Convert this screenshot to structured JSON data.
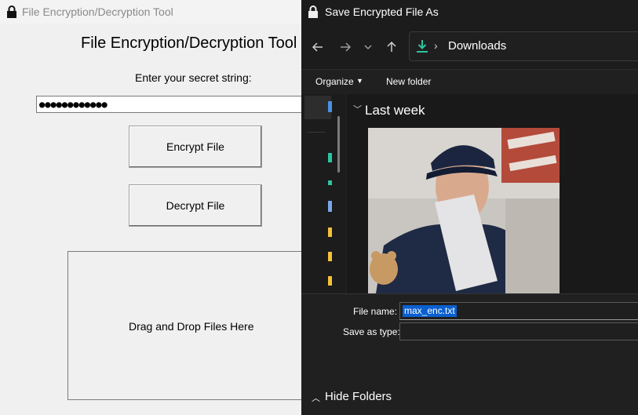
{
  "app": {
    "window_title": "File Encryption/Decryption Tool",
    "heading": "File Encryption/Decryption Tool",
    "secret_prompt": "Enter your secret string:",
    "secret_value": "●●●●●●●●●●●●",
    "encrypt_label": "Encrypt File",
    "decrypt_label": "Decrypt File",
    "drop_label": "Drag and Drop Files Here"
  },
  "dialog": {
    "title": "Save Encrypted File As",
    "nav": {
      "back_icon": "arrow-left-icon",
      "forward_icon": "arrow-right-icon",
      "recent_icon": "chevron-down-icon",
      "up_icon": "arrow-up-icon"
    },
    "address": {
      "separator": "›",
      "location": "Downloads",
      "icon": "download-icon"
    },
    "commands": {
      "organize": "Organize",
      "new_folder": "New folder"
    },
    "group_label": "Last week",
    "file_name_label": "File name:",
    "file_name_value": "max_enc.txt",
    "save_type_label": "Save as type:",
    "save_type_value": "",
    "hide_folders": "Hide Folders"
  },
  "colors": {
    "dialog_bg": "#202020",
    "selection": "#0a60d0",
    "download_accent": "#2ec4a0",
    "folder_yellow": "#f3c13a"
  }
}
